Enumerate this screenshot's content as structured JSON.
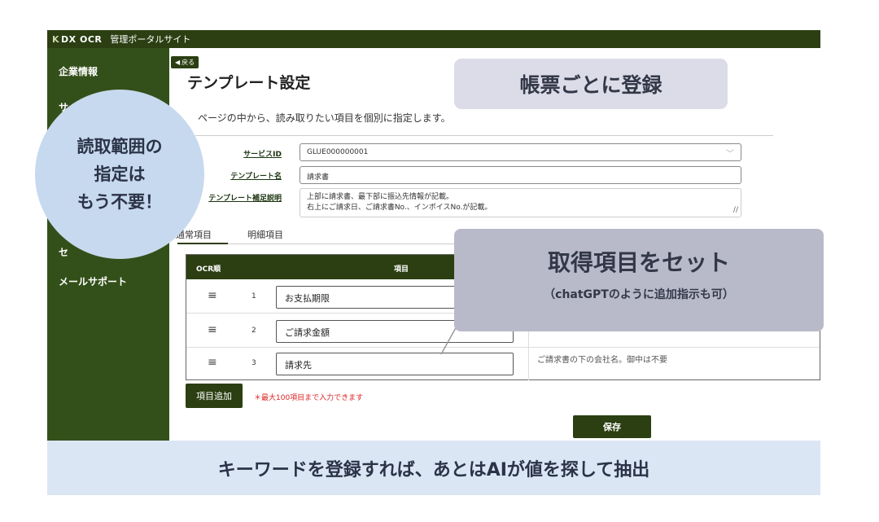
{
  "topbar": {
    "logo": "DX OCR",
    "logo_mark": "K",
    "site_title": "管理ポータルサイト"
  },
  "sidebar": {
    "items": [
      {
        "label": "企業情報"
      },
      {
        "label": "サ"
      },
      {
        "label": "セ"
      },
      {
        "label": "メールサポート"
      }
    ]
  },
  "main": {
    "back_label": "戻る",
    "title": "テンプレート設定",
    "description": "ページの中から、読み取りたい項目を個別に指定します。",
    "form": {
      "service_id_label": "サービスID",
      "service_id_value": "GLUE000000001",
      "template_name_label": "テンプレート名",
      "template_name_value": "請求書",
      "template_note_label": "テンプレート補足説明",
      "template_note_line1": "上部に請求書、最下部に振込先情報が記載。",
      "template_note_line2": "右上にご請求日、ご請求書No.、インボイスNo.が記載。"
    },
    "tabs": [
      {
        "label": "通常項目"
      },
      {
        "label": "明細項目"
      }
    ],
    "table": {
      "col_order": "OCR順",
      "col_item": "項目",
      "rows": [
        {
          "num": "1",
          "item": "お支払期限",
          "desc": ""
        },
        {
          "num": "2",
          "item": "ご請求金額",
          "desc": ""
        },
        {
          "num": "3",
          "item": "請求先",
          "desc": "ご請求書の下の会社名。御中は不要"
        }
      ]
    },
    "add_button": "項目追加",
    "add_note": "＊最大100項目まで入力できます",
    "save_button": "保存"
  },
  "callouts": {
    "top": "帳票ごとに登録",
    "mid_title": "取得項目をセット",
    "mid_sub": "（chatGPTのように追加指示も可）",
    "bubble_line1": "読取範囲の",
    "bubble_line2": "指定は",
    "bubble_line3": "もう不要！",
    "banner": "キーワードを登録すれば、あとはAIが値を探して抽出"
  },
  "colors": {
    "dark_green": "#2b3f12",
    "sidebar_green": "#34501a",
    "bubble_blue": "#c7d9ee",
    "banner_blue": "#dbe6f4"
  }
}
